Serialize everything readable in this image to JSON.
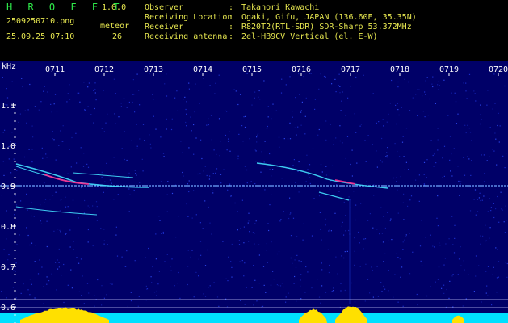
{
  "app": {
    "logo": "H R O F F T",
    "version": "1.0.0"
  },
  "capture": {
    "filename": "2509250710.png",
    "datetime": "25.09.25 07:10",
    "meteor_label": "meteor",
    "meteor_count": "26"
  },
  "info": {
    "separator": ":",
    "rows": [
      {
        "label": "Observer",
        "value": "Takanori Kawachi"
      },
      {
        "label": "Receiving Location",
        "value": "Ogaki, Gifu, JAPAN (136.60E, 35.35N)"
      },
      {
        "label": "Receiver",
        "value": "R820T2(RTL-SDR) SDR-Sharp 53.372MHz"
      },
      {
        "label": "Receiving antenna",
        "value": "2el-HB9CV Vertical (el. E-W)"
      }
    ]
  },
  "spectrogram": {
    "y_unit": "kHz",
    "y_ticks": [
      {
        "label": "1.1",
        "value": 1.1
      },
      {
        "label": "1.0",
        "value": 1.0
      },
      {
        "label": "0.9",
        "value": 0.9
      },
      {
        "label": "0.8",
        "value": 0.8
      },
      {
        "label": "0.7",
        "value": 0.7
      },
      {
        "label": "0.6",
        "value": 0.6
      }
    ],
    "x_ticks": [
      "0711",
      "0712",
      "0713",
      "0714",
      "0715",
      "0716",
      "0717",
      "0718",
      "0719",
      "0720"
    ],
    "carrier_khz": 0.9,
    "colors": {
      "background": "#000068",
      "carrier": "#6fa8ff",
      "trace": "#44e0ff",
      "peak": "#ff3090",
      "axis": "#ffffff",
      "bars": "#ffe000",
      "baseline": "#00e0ff"
    }
  }
}
